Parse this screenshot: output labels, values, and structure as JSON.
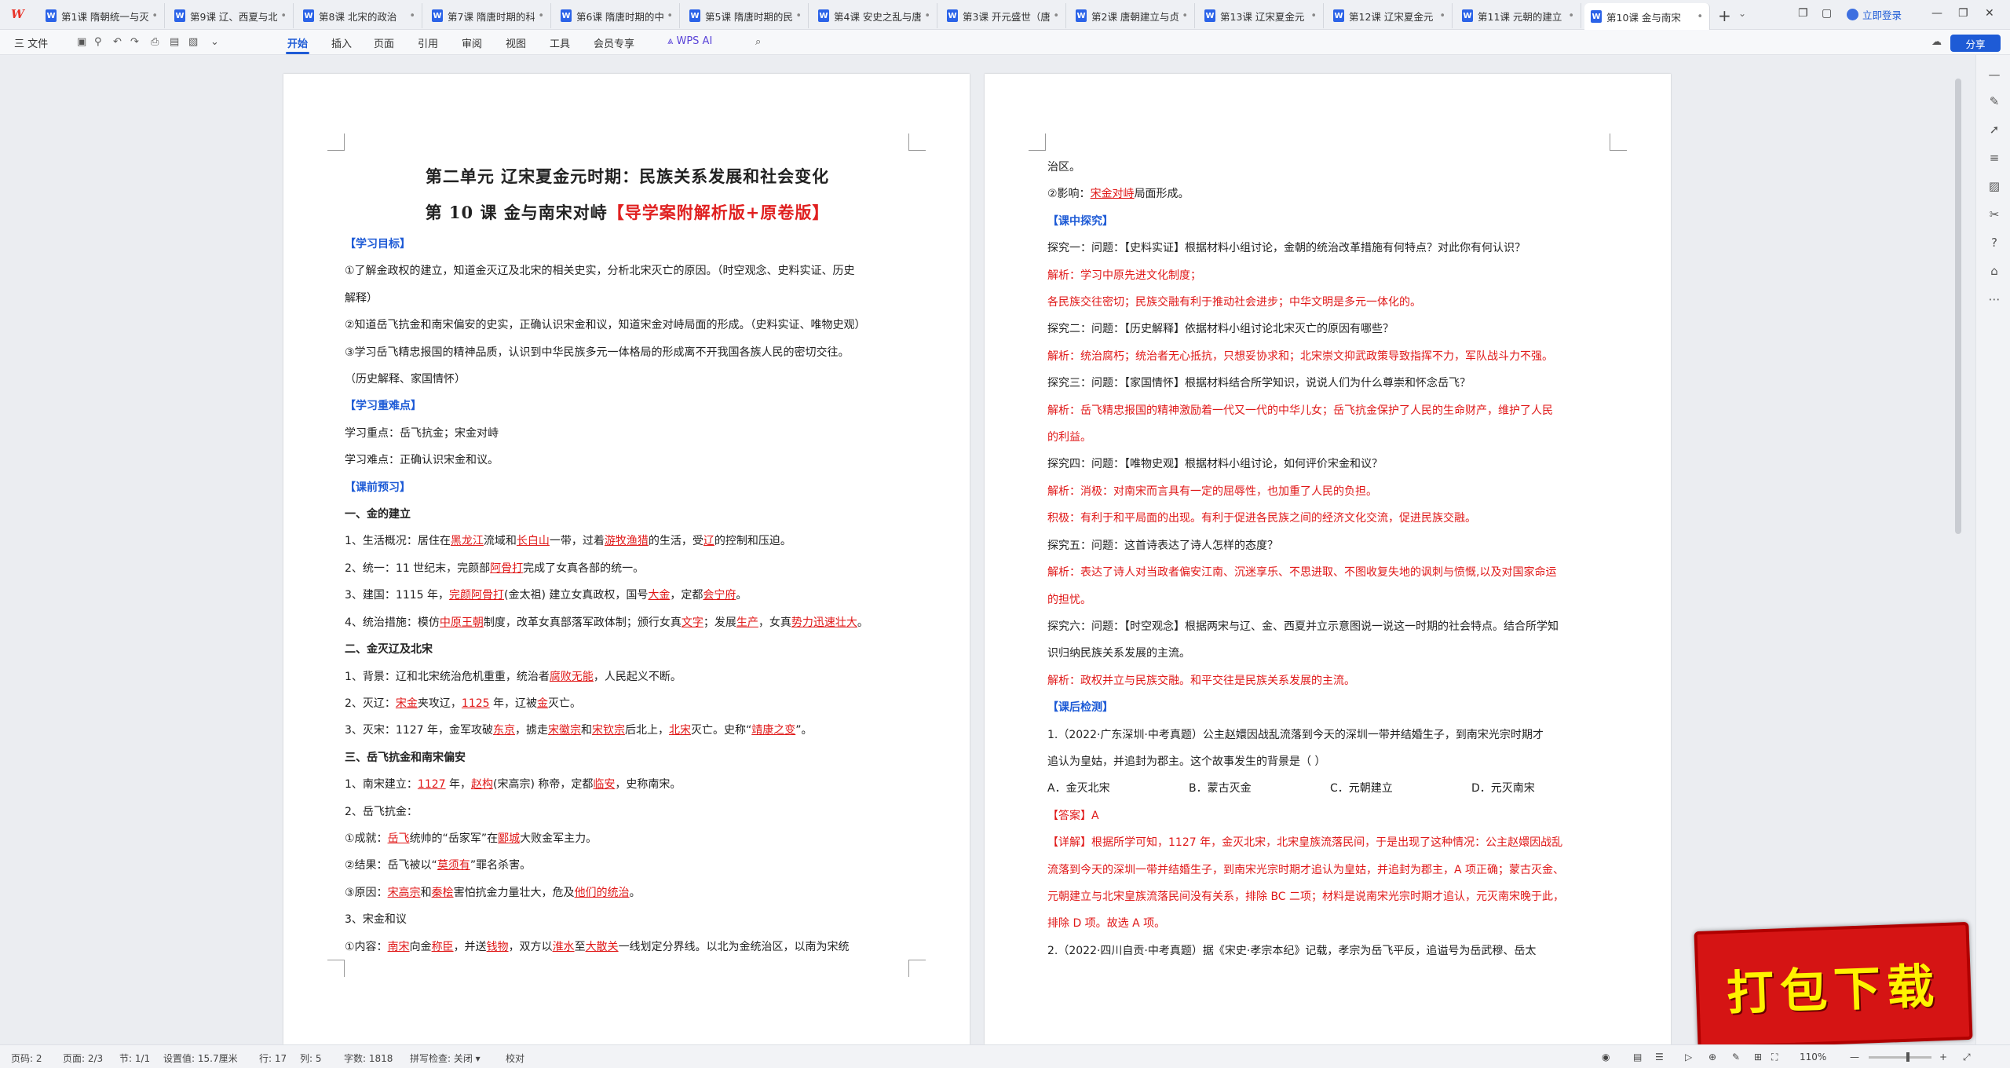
{
  "tabs": [
    {
      "label": "第1课 隋朝统一与灭亡"
    },
    {
      "label": "第9课 辽、西夏与北宋"
    },
    {
      "label": "第8课 北宋的政治"
    },
    {
      "label": "第7课 隋唐时期的科"
    },
    {
      "label": "第6课 隋唐时期的中"
    },
    {
      "label": "第5课 隋唐时期的民"
    },
    {
      "label": "第4课 安史之乱与唐"
    },
    {
      "label": "第3课 开元盛世（唐"
    },
    {
      "label": "第2课 唐朝建立与贞"
    },
    {
      "label": "第13课 辽宋夏金元"
    },
    {
      "label": "第12课 辽宋夏金元"
    },
    {
      "label": "第11课 元朝的建立"
    },
    {
      "label": "第10课 金与南宋"
    }
  ],
  "header": {
    "logo": "W",
    "login": "立即登录"
  },
  "toolbar": {
    "file": "三 文件",
    "menus": [
      "开始",
      "插入",
      "页面",
      "引用",
      "审阅",
      "视图",
      "工具",
      "会员专享"
    ],
    "wps_ai": "WPS AI",
    "share": "分享"
  },
  "page1": {
    "title1": "第二单元  辽宋夏金元时期：民族关系发展和社会变化",
    "title2_black": "第 10 课   金与南宋对峙",
    "title2_red": "【导学案附解析版+原卷版】",
    "h_goals": "【学习目标】",
    "goal1": "①了解金政权的建立，知道金灭辽及北宋的相关史实，分析北宋灭亡的原因。（时空观念、史料实证、历史",
    "goal1b": "解释）",
    "goal2": "②知道岳飞抗金和南宋偏安的史实，正确认识宋金和议，知道宋金对峙局面的形成。（史料实证、唯物史观）",
    "goal3": "③学习岳飞精忠报国的精神品质，认识到中华民族多元一体格局的形成离不开我国各族人民的密切交往。",
    "goal3b": "（历史解释、家国情怀）",
    "h_key": "【学习重难点】",
    "key1": "学习重点：岳飞抗金；宋金对峙",
    "key2": "学习难点：正确认识宋金和议。",
    "h_pre": "【课前预习】",
    "s1": "一、金的建立",
    "l1": [
      "1、生活概况：居住在",
      "黑龙江",
      "流域和",
      "长白山",
      "一带，过着",
      "游牧渔猎",
      "的生活，受",
      "辽",
      "的控制和压迫。"
    ],
    "l2": [
      "2、统一：11 世纪末，完颜部",
      "阿骨打",
      "完成了女真各部的统一。"
    ],
    "l3": [
      "3、建国：1115 年，",
      "完颜阿骨打",
      "(金太祖) 建立女真政权，国号",
      "大金",
      "，定都",
      "会宁府",
      "。"
    ],
    "l4": [
      "4、统治措施：模仿",
      "中原王朝",
      "制度，改革女真部落军政体制；颁行女真",
      "文字",
      "；发展",
      "生产",
      "，女真",
      "势力迅速壮大",
      "。"
    ],
    "s2": "二、金灭辽及北宋",
    "m1": [
      "1、背景：辽和北宋统治危机重重，统治者",
      "腐败无能",
      "，人民起义不断。"
    ],
    "m2": [
      "2、灭辽：",
      "宋金",
      "夹攻辽，",
      "1125",
      " 年，辽被",
      "金",
      "灭亡。"
    ],
    "m3": [
      "3、灭宋：1127 年，金军攻破",
      "东京",
      "，掳走",
      "宋徽宗",
      "和",
      "宋钦宗",
      "后北上，",
      "北宋",
      "灭亡。史称“",
      "靖康之变",
      "”。"
    ],
    "s3": "三、岳飞抗金和南宋偏安",
    "n1": [
      "1、南宋建立：",
      "1127",
      " 年，",
      "赵构",
      "(宋高宗) 称帝，定都",
      "临安",
      "，史称南宋。"
    ],
    "n2": "2、岳飞抗金：",
    "n3": [
      "①成就：",
      "岳飞",
      "统帅的“岳家军”在",
      "郾城",
      "大败金军主力。"
    ],
    "n4": [
      "②结果：岳飞被以“",
      "莫须有",
      "”罪名杀害。"
    ],
    "n5": [
      "③原因：",
      "宋高宗",
      "和",
      "秦桧",
      "害怕抗金力量壮大，危及",
      "他们的统治",
      "。"
    ],
    "n6": "3、宋金和议",
    "n7": [
      "①内容：",
      "南宋",
      "向金",
      "称臣",
      "，并送",
      "钱物",
      "，双方以",
      "淮水",
      "至",
      "大散关",
      "一线划定分界线。以北为金统治区，以南为宋统"
    ]
  },
  "page2": {
    "p1": "治区。",
    "p2": [
      "②影响：",
      "宋金对峙",
      "局面形成。"
    ],
    "h_class": "【课中探究】",
    "q1": "探究一：问题：【史料实证】根据材料小组讨论，金朝的统治改革措施有何特点？对此你有何认识？",
    "a1": "解析：学习中原先进文化制度；",
    "a1b": "各民族交往密切；民族交融有利于推动社会进步；中华文明是多元一体化的。",
    "q2": "探究二：问题：【历史解释】依据材料小组讨论北宋灭亡的原因有哪些？",
    "a2": "解析：统治腐朽；统治者无心抵抗，只想妥协求和；北宋崇文抑武政策导致指挥不力，军队战斗力不强。",
    "q3": "探究三：问题：【家国情怀】根据材料结合所学知识，说说人们为什么尊崇和怀念岳飞？",
    "a3": "解析：岳飞精忠报国的精神激励着一代又一代的中华儿女；岳飞抗金保护了人民的生命财产，维护了人民",
    "a3b": "的利益。",
    "q4": "探究四：问题：【唯物史观】根据材料小组讨论，如何评价宋金和议？",
    "a4": "解析：消极：对南宋而言具有一定的屈辱性，也加重了人民的负担。",
    "a4b": "积极：有利于和平局面的出现。有利于促进各民族之间的经济文化交流，促进民族交融。",
    "q5": "探究五：问题：这首诗表达了诗人怎样的态度？",
    "a5": "解析：表达了诗人对当政者偏安江南、沉迷享乐、不思进取、不图收复失地的讽刺与愤慨,以及对国家命运",
    "a5b": "的担忧。",
    "q6": "探究六：问题：【时空观念】根据两宋与辽、金、西夏并立示意图说一说这一时期的社会特点。结合所学知",
    "q6b": "识归纳民族关系发展的主流。",
    "a6": "解析：政权并立与民族交融。和平交往是民族关系发展的主流。",
    "h_after": "【课后检测】",
    "t1": "1.（2022·广东深圳·中考真题）公主赵嬛因战乱流落到今天的深圳一带并结婚生子，到南宋光宗时期才",
    "t1b": "追认为皇姑，并追封为郡主。这个故事发生的背景是（          ）",
    "opts": [
      "A．金灭北宋",
      "B．蒙古灭金",
      "C．元朝建立",
      "D．元灭南宋"
    ],
    "ans": "【答案】A",
    "det1": "【详解】根据所学可知，1127 年，金灭北宋，北宋皇族流落民间，于是出现了这种情况：公主赵嬛因战乱",
    "det2": "流落到今天的深圳一带并结婚生子，到南宋光宗时期才追认为皇姑，并追封为郡主，A 项正确；蒙古灭金、",
    "det3": "元朝建立与北宋皇族流落民间没有关系，排除 BC 二项；材料是说南宋光宗时期才追认，元灭南宋晚于此，",
    "det4": "排除 D 项。故选 A 项。",
    "t2": "2.（2022·四川自贡·中考真题）据《宋史·孝宗本纪》记载，孝宗为岳飞平反，追谥号为岳武穆、岳太"
  },
  "banner": "打包下载",
  "status": {
    "page_no": "页码: 2",
    "pages": "页面: 2/3",
    "section": "节: 1/1",
    "setting": "设置值: 15.7厘米",
    "row": "行: 17",
    "col": "列: 5",
    "words": "字数: 1818",
    "spell": "拼写检查: 关闭 ▾",
    "proof": "校对",
    "zoom": "110%"
  }
}
